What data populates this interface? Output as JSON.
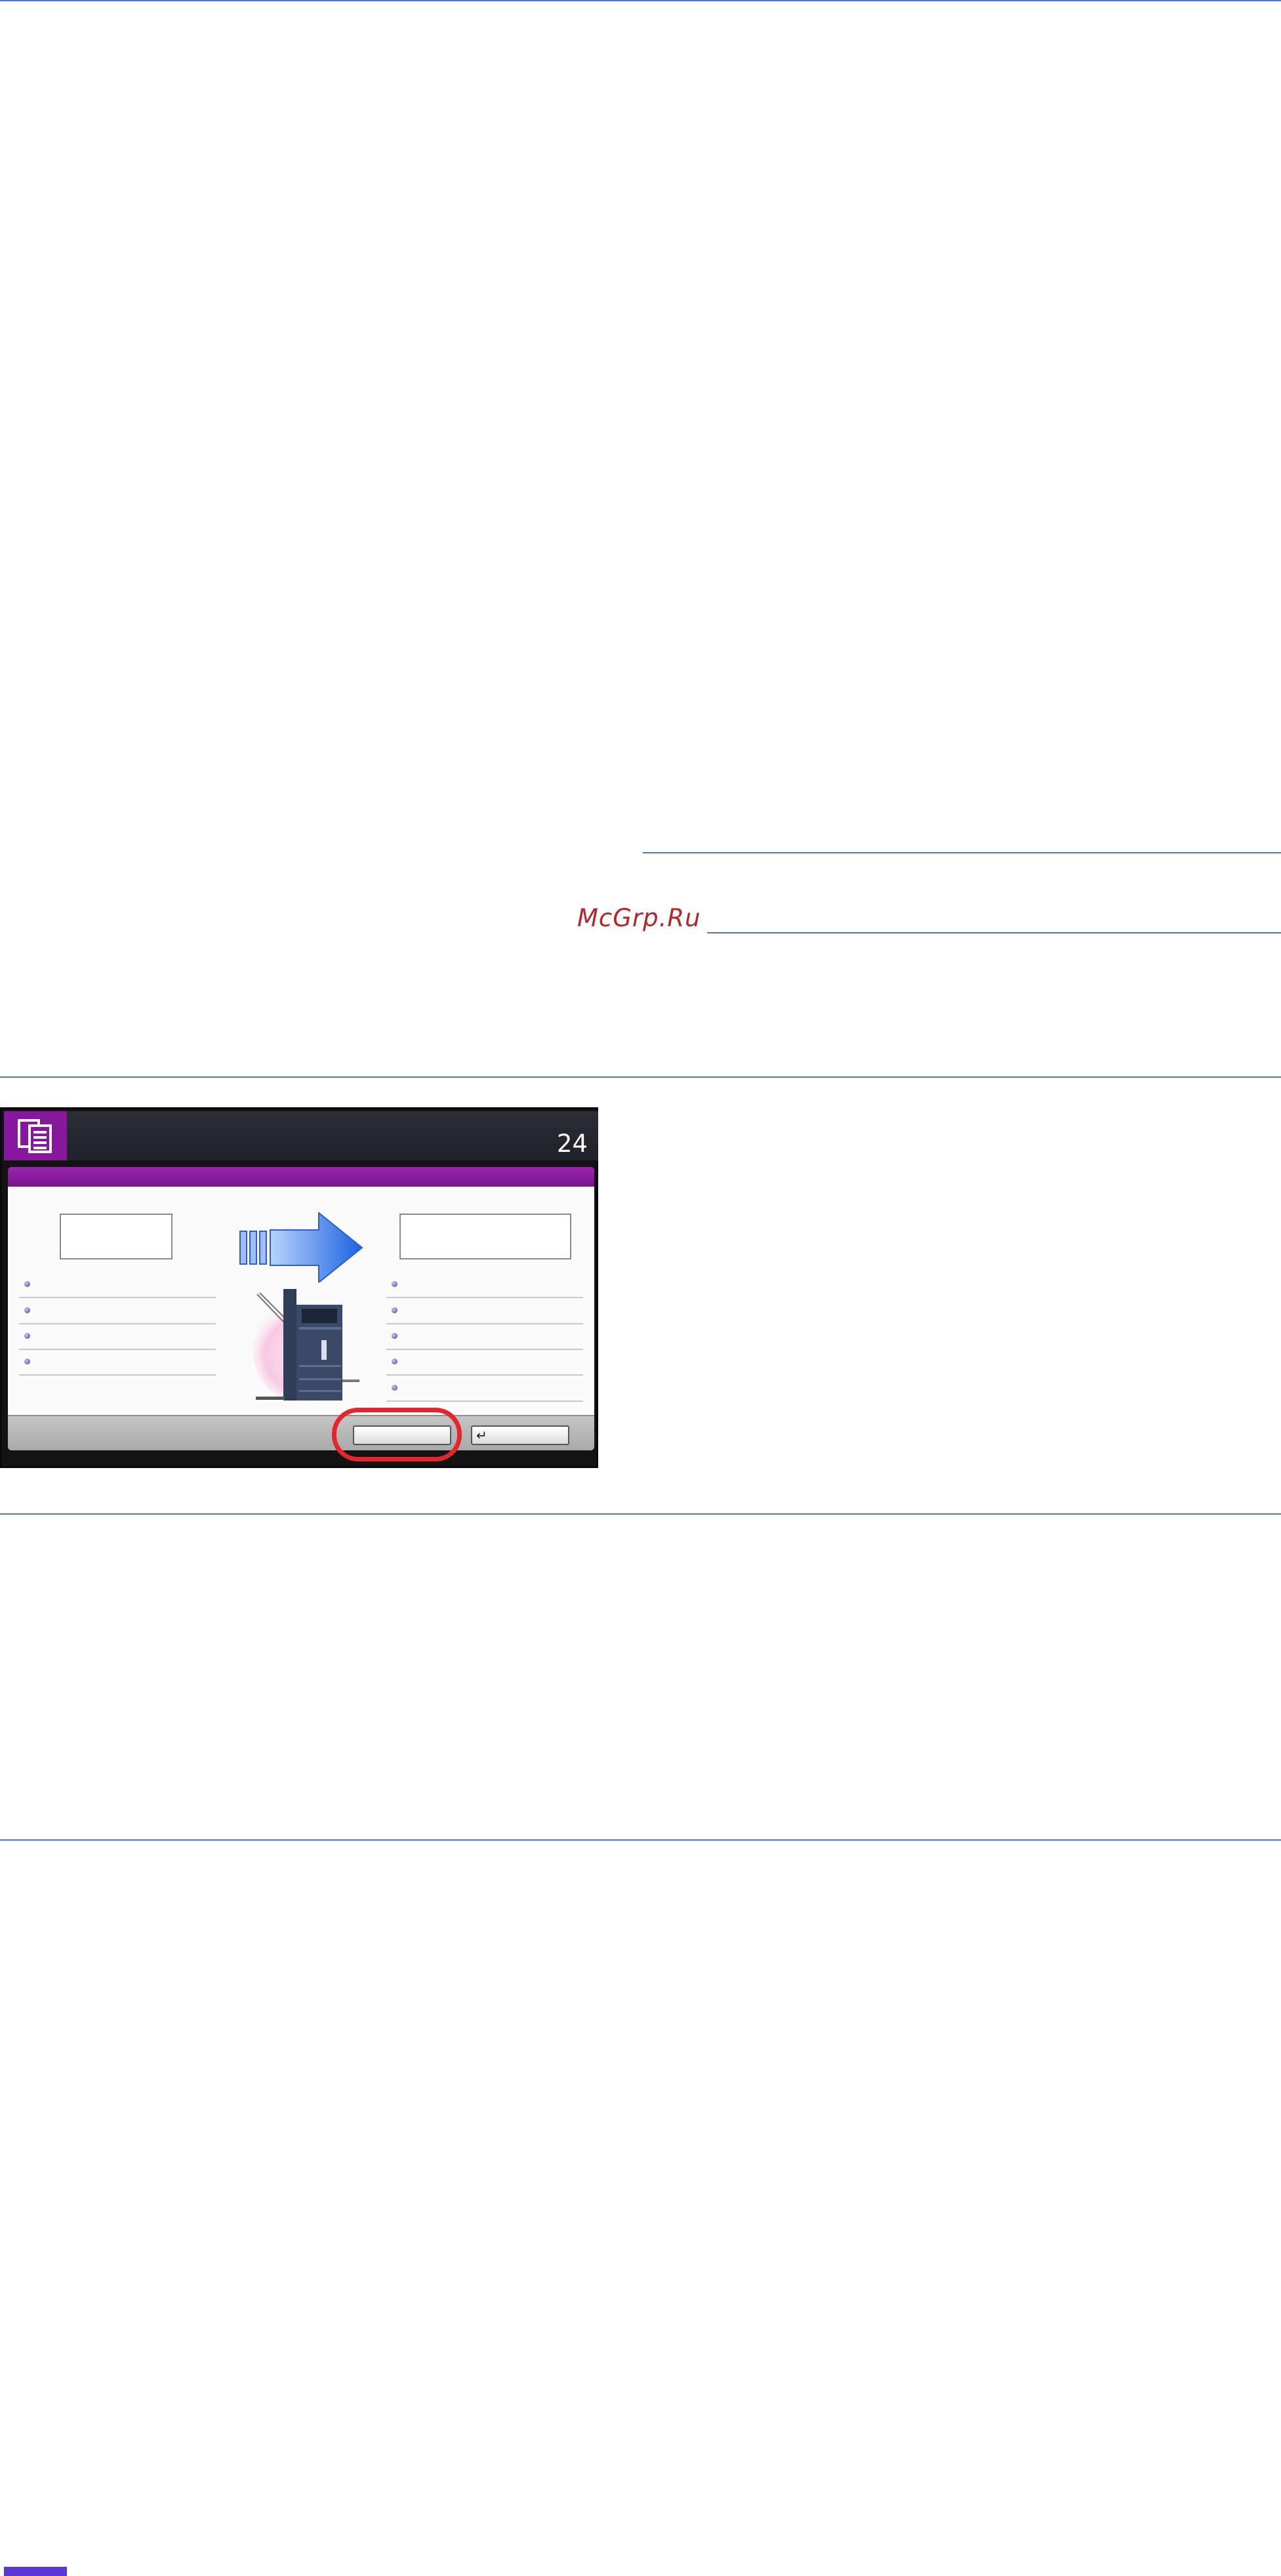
{
  "watermark": "McGrp.Ru",
  "panel": {
    "counter": "24",
    "app_icon": "copy-documents-icon",
    "return_icon": "↵",
    "colors": {
      "header_bg": "#23252d",
      "accent_purple": "#87189e",
      "arrow_blue": "#1c62e0",
      "highlight_red": "#e3262b",
      "status_strip": "#5b37d6"
    }
  }
}
